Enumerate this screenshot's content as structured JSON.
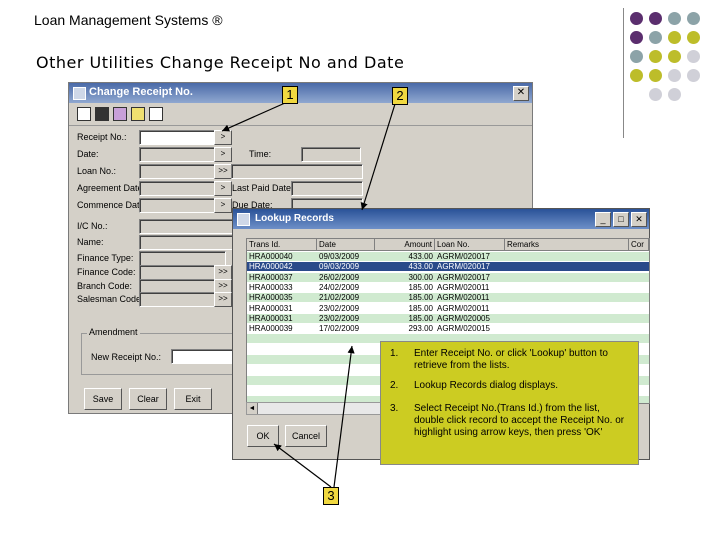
{
  "header": {
    "title": "Loan Management Systems ®"
  },
  "slide_title": "Other Utilities Change Receipt No and Date",
  "main_window": {
    "title": "Change Receipt No.",
    "close": "✕",
    "fields": {
      "receipt_no": "Receipt No.:",
      "date": "Date:",
      "time": "Time:",
      "loan_no": "Loan No.:",
      "agreement_date": "Agreement Date:",
      "last_paid_date": "Last Paid Date:",
      "commence_date": "Commence Date:",
      "due_date": "Due Date:",
      "id_no": "I/C No.:",
      "name": "Name:",
      "finance_type": "Finance Type:",
      "finance_code": "Finance Code:",
      "branch_code": "Branch Code:",
      "salesman_code": "Salesman Code:"
    },
    "amendment": {
      "legend": "Amendment",
      "new_receipt": "New Receipt No.:"
    },
    "buttons": {
      "save": "Save",
      "clear": "Clear",
      "exit": "Exit",
      "single": ">",
      "double": ">>"
    }
  },
  "lookup_window": {
    "title": "Lookup Records",
    "columns": [
      "Trans Id.",
      "Date",
      "Amount",
      "Loan No.",
      "Remarks",
      "Cor"
    ],
    "rows": [
      [
        "HRA000040",
        "09/03/2009",
        "433.00",
        "AGRM/020017",
        ""
      ],
      [
        "HRA000042",
        "09/03/2009",
        "433.00",
        "AGRM/020017",
        ""
      ],
      [
        "HRA000037",
        "26/02/2009",
        "300.00",
        "AGRM/020017",
        ""
      ],
      [
        "HRA000033",
        "24/02/2009",
        "185.00",
        "AGRM/020011",
        ""
      ],
      [
        "HRA000035",
        "21/02/2009",
        "185.00",
        "AGRM/020011",
        ""
      ],
      [
        "HRA000031",
        "23/02/2009",
        "185.00",
        "AGRM/020011",
        ""
      ],
      [
        "HRA000031",
        "23/02/2009",
        "185.00",
        "AGRM/020005",
        ""
      ],
      [
        "HRA000039",
        "17/02/2009",
        "293.00",
        "AGRM/020015",
        ""
      ]
    ],
    "buttons": {
      "ok": "OK",
      "cancel": "Cancel"
    },
    "scroll_arrow": "◄"
  },
  "callouts": [
    "1",
    "2",
    "3"
  ],
  "notes": [
    {
      "num": "1.",
      "text": "Enter Receipt No. or click 'Lookup' button to retrieve from the lists."
    },
    {
      "num": "2.",
      "text": "Lookup Records dialog displays."
    },
    {
      "num": "3.",
      "text": "Select Receipt No.(Trans Id.) from the list, double click record to accept the Receipt No. or highlight using arrow keys, then press 'OK'"
    }
  ],
  "colors": {
    "deco_purple": "#5b2e6e",
    "deco_gray": "#8ca3a8",
    "deco_yellow": "#bdbd2a",
    "deco_light": "#d0d0d8",
    "row_green": "#d0ead0",
    "row_selected": "#2a4a8a",
    "note_bg": "#cccc22"
  }
}
